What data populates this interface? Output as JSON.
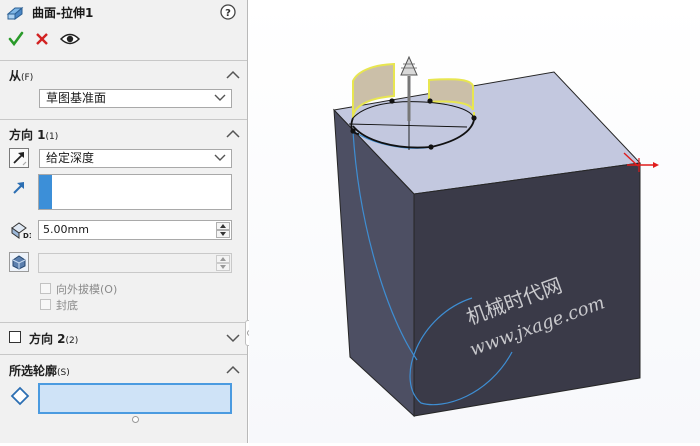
{
  "feature": {
    "title": "曲面-拉伸1",
    "help_icon": "help-icon",
    "ok_icon": "check-icon",
    "cancel_icon": "close-icon",
    "preview_icon": "eye-icon"
  },
  "from_section": {
    "title": "从",
    "shortcut": "(F)",
    "start_condition": "草图基准面"
  },
  "direction1_section": {
    "title": "方向 1",
    "shortcut": "(1)",
    "end_condition": "给定深度",
    "direction_value": "",
    "depth": "5.00mm",
    "draft_value": "",
    "draft_outward_label": "向外拔模",
    "draft_outward_shortcut": "(O)",
    "cap_end_label": "封底"
  },
  "direction2_section": {
    "title": "方向 2",
    "shortcut": "(2)",
    "enabled": false
  },
  "contours_section": {
    "title": "所选轮廓",
    "shortcut": "(S)",
    "items": []
  },
  "watermark": {
    "line1": "机械时代网",
    "line2": "www.jxage.com"
  },
  "colors": {
    "accent_blue": "#3c8fd8",
    "ok_green": "#2a9a2a",
    "cancel_red": "#d22222",
    "box_top": "#c3c8df",
    "box_front": "#3a3a48",
    "box_left": "#4d4f63",
    "surface_yellow": "#e8e650"
  }
}
